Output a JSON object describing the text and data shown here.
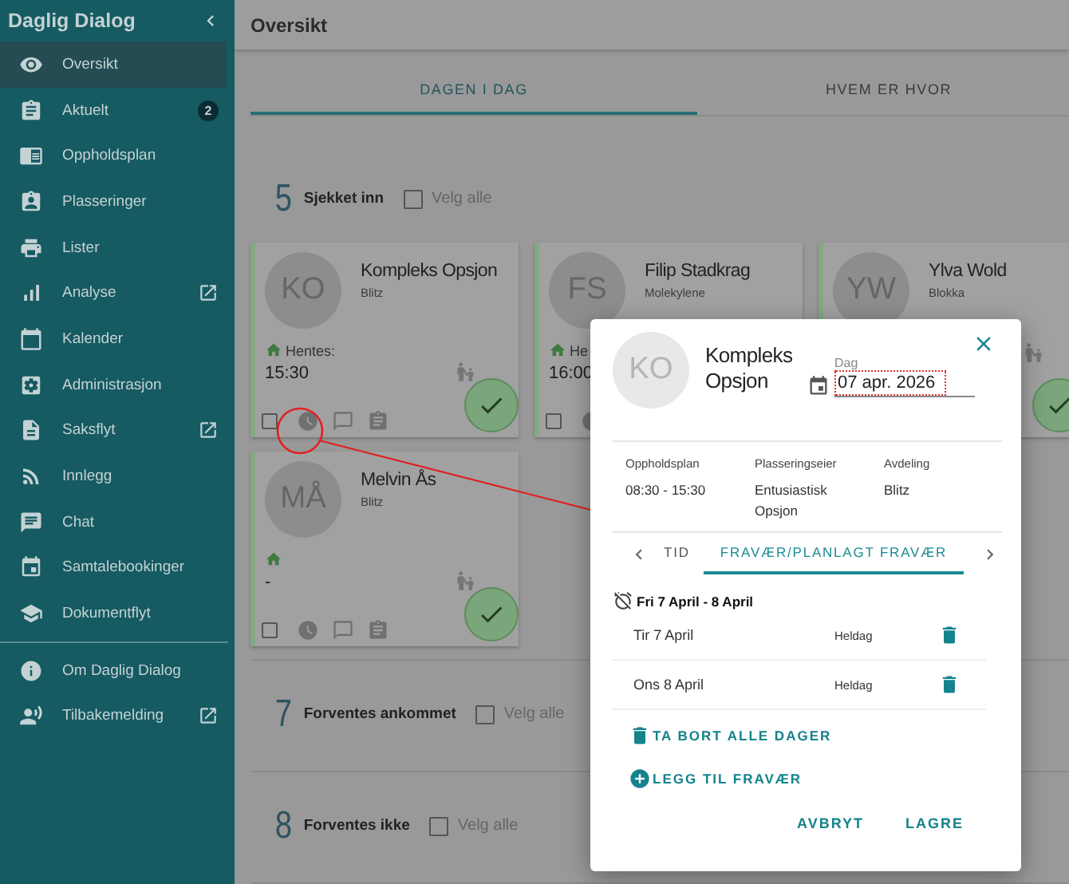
{
  "sidebar": {
    "title": "Daglig Dialog",
    "items": [
      {
        "label": "Oversikt",
        "selected": true,
        "external": false
      },
      {
        "label": "Aktuelt",
        "selected": false,
        "external": false,
        "badge": "2"
      },
      {
        "label": "Oppholdsplan",
        "selected": false,
        "external": false
      },
      {
        "label": "Plasseringer",
        "selected": false,
        "external": false
      },
      {
        "label": "Lister",
        "selected": false,
        "external": false
      },
      {
        "label": "Analyse",
        "selected": false,
        "external": true
      },
      {
        "label": "Kalender",
        "selected": false,
        "external": false
      },
      {
        "label": "Administrasjon",
        "selected": false,
        "external": false
      },
      {
        "label": "Saksflyt",
        "selected": false,
        "external": true
      },
      {
        "label": "Innlegg",
        "selected": false,
        "external": false
      },
      {
        "label": "Chat",
        "selected": false,
        "external": false
      },
      {
        "label": "Samtalebookinger",
        "selected": false,
        "external": false
      },
      {
        "label": "Dokumentflyt",
        "selected": false,
        "external": false
      }
    ],
    "footer_items": [
      {
        "label": "Om Daglig Dialog",
        "selected": false,
        "external": false
      },
      {
        "label": "Tilbakemelding",
        "selected": false,
        "external": true
      }
    ]
  },
  "header": {
    "title": "Oversikt"
  },
  "tabs": [
    {
      "label": "DAGEN I DAG",
      "selected": true
    },
    {
      "label": "HVEM ER HVOR",
      "selected": false
    }
  ],
  "sections": [
    {
      "count": "5",
      "title": "Sjekket inn",
      "select_all": {
        "label": "Velg alle",
        "checked": false
      },
      "cards": [
        {
          "initials": "KO",
          "name": "Kompleks Opsjon",
          "group": "Blitz",
          "pickup_label": "Hentes:",
          "time": "15:30",
          "guardian_icon": true,
          "checked_in": true,
          "tools": [
            {
              "kind": "checkbox",
              "checked": false
            },
            {
              "kind": "clock"
            },
            {
              "kind": "chat"
            },
            {
              "kind": "clipboard"
            }
          ]
        },
        {
          "initials": "FS",
          "name": "Filip Stadkrag",
          "group": "Molekylene",
          "pickup_label": "He",
          "time": "16:00",
          "guardian_icon": false,
          "tools": [
            {
              "kind": "checkbox",
              "checked": false
            },
            {
              "kind": "clock"
            }
          ]
        },
        {
          "initials": "YW",
          "name": "Ylva Wold",
          "group": "Blokka",
          "guardian_icon": true,
          "checked_in": true
        },
        {
          "initials": "MÅ",
          "name": "Melvin Ås",
          "group": "Blitz",
          "time": "-",
          "guardian_icon": true,
          "checked_in": true,
          "tools": [
            {
              "kind": "checkbox",
              "checked": false
            },
            {
              "kind": "clock"
            },
            {
              "kind": "chat"
            },
            {
              "kind": "clipboard"
            }
          ]
        }
      ]
    },
    {
      "count": "7",
      "title": "Forventes ankommet",
      "select_all": {
        "label": "Velg alle",
        "checked": false
      }
    },
    {
      "count": "8",
      "title": "Forventes ikke",
      "select_all": {
        "label": "Velg alle",
        "checked": false
      }
    }
  ],
  "dialog": {
    "initials": "KO",
    "name": "Kompleks Opsjon",
    "date_field": {
      "label": "Dag",
      "value": "07 apr. 2026"
    },
    "info": [
      {
        "label": "Oppholdsplan",
        "value": "08:30 - 15:30"
      },
      {
        "label": "Plasseringseier",
        "value": "Entusiastisk Opsjon"
      },
      {
        "label": "Avdeling",
        "value": "Blitz"
      }
    ],
    "tabs": [
      {
        "label": "TID",
        "selected": false
      },
      {
        "label": "FRAVÆR/PLANLAGT FRAVÆR",
        "selected": true
      }
    ],
    "absence": {
      "title": "Fri 7 April - 8 April",
      "days": [
        {
          "day": "Tir 7 April",
          "duration": "Heldag"
        },
        {
          "day": "Ons 8 April",
          "duration": "Heldag"
        }
      ]
    },
    "remove_all": "TA BORT ALLE DAGER",
    "add": "LEGG TIL FRAVÆR",
    "buttons": [
      "AVBRYT",
      "LAGRE"
    ]
  }
}
